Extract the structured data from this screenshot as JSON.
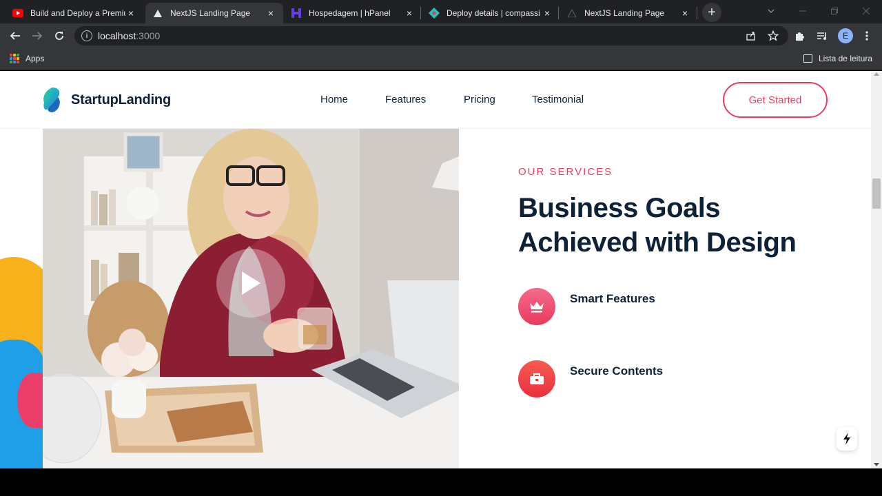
{
  "browser": {
    "tabs": [
      {
        "title": "Build and Deploy a Premium",
        "icon": "youtube-icon",
        "active": false
      },
      {
        "title": "NextJS Landing Page",
        "icon": "nextjs-icon",
        "active": true
      },
      {
        "title": "Hospedagem | hPanel",
        "icon": "hostinger-icon",
        "active": false
      },
      {
        "title": "Deploy details | compassi",
        "icon": "netlify-icon",
        "active": false
      },
      {
        "title": "NextJS Landing Page",
        "icon": "nextjs-icon",
        "active": false
      }
    ],
    "close_glyph": "×",
    "new_tab_glyph": "+",
    "url_host": "localhost",
    "url_port": ":3000",
    "profile_initial": "E",
    "bookmarks": {
      "apps_label": "Apps",
      "reading_list_label": "Lista de leitura"
    }
  },
  "header": {
    "logo_text": "StartupLanding",
    "nav": [
      "Home",
      "Features",
      "Pricing",
      "Testimonial"
    ],
    "cta_label": "Get Started"
  },
  "services": {
    "eyebrow": "OUR SERVICES",
    "heading_line1": "Business Goals",
    "heading_line2": "Achieved with Design",
    "features": [
      {
        "title": "Smart Features",
        "icon": "crown-icon",
        "color": "#f05a7e"
      },
      {
        "title": "Secure Contents",
        "icon": "briefcase-icon",
        "color": "#f0423a"
      }
    ]
  },
  "colors": {
    "accent": "#ea3a60",
    "heading": "#0f2137"
  }
}
